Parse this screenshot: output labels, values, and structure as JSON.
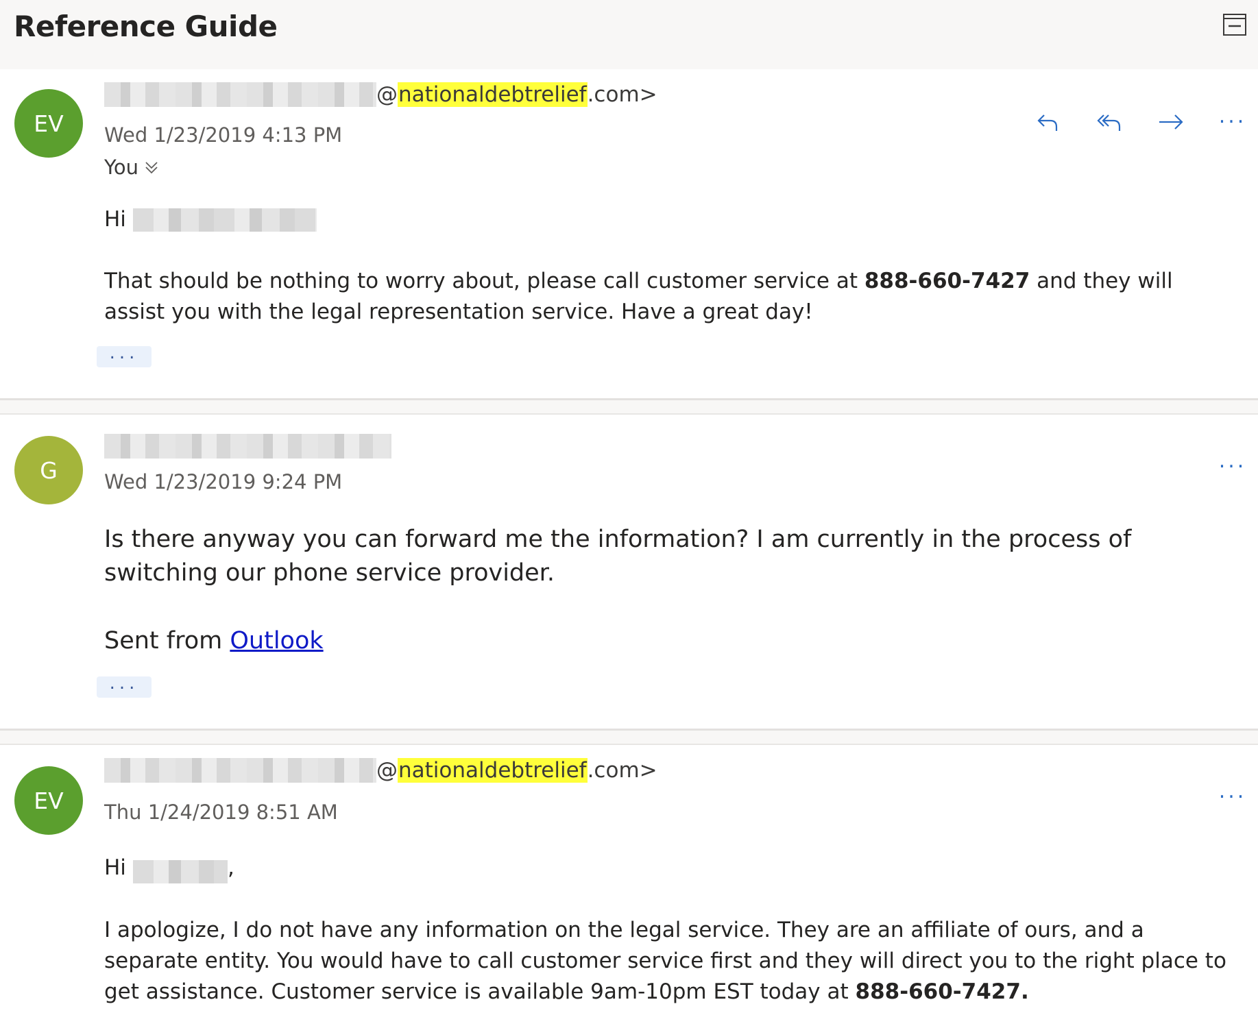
{
  "header": {
    "title": "Reference Guide",
    "popout_icon": "popout-window-icon"
  },
  "colors": {
    "avatar_ev": "#5b9f2e",
    "avatar_g": "#a4b53b",
    "action_blue": "#2b6cc4",
    "highlight": "#ffff3b",
    "link": "#0f1ac7"
  },
  "messages": [
    {
      "avatar_initials": "EV",
      "from_at": "@",
      "from_highlight": "nationaldebtrelief",
      "from_suffix": ".com>",
      "date": "Wed 1/23/2019 4:13 PM",
      "to_label": "You",
      "greeting": "Hi",
      "body_before": "That should be nothing to worry about, please call customer service at ",
      "body_phone": "888-660-7427",
      "body_after": " and they will assist you with the legal representation service. Have a great day!",
      "more_label": "..."
    },
    {
      "avatar_initials": "G",
      "date": "Wed 1/23/2019 9:24 PM",
      "body": "Is there anyway you can forward me the information? I am currently in the process of switching our phone service provider.",
      "signature_prefix": "Sent from ",
      "signature_link": "Outlook",
      "more_label": "..."
    },
    {
      "avatar_initials": "EV",
      "from_at": "@",
      "from_highlight": "nationaldebtrelief",
      "from_suffix": ".com>",
      "date": "Thu 1/24/2019 8:51 AM",
      "greeting": "Hi",
      "greeting_comma": ",",
      "body_before": "I apologize, I do not have any information on the legal service. They are an affiliate of ours, and a separate entity. You would have to call customer service first and they will direct you to the right place to get assistance. Customer service is available 9am-10pm EST today at ",
      "body_phone": "888-660-7427."
    }
  ],
  "actions": {
    "more": "..."
  }
}
